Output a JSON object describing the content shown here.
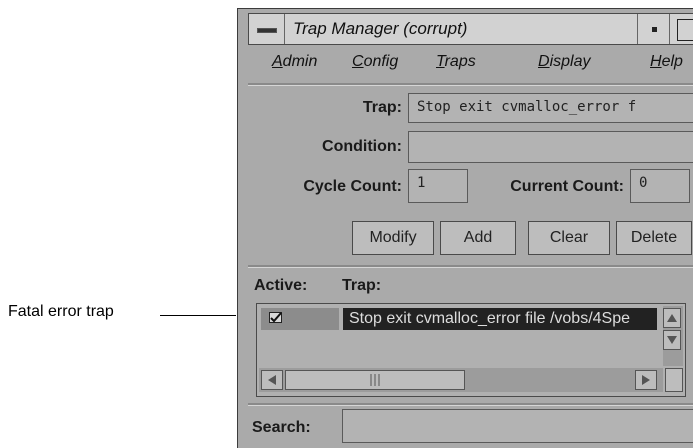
{
  "callout": {
    "label": "Fatal error trap"
  },
  "window": {
    "title": "Trap Manager (corrupt)"
  },
  "menubar": {
    "items": [
      {
        "label": "Admin",
        "underline": "A",
        "rest": "dmin"
      },
      {
        "label": "Config",
        "underline": "C",
        "rest": "onfig"
      },
      {
        "label": "Traps",
        "underline": "T",
        "rest": "raps"
      },
      {
        "label": "Display",
        "underline": "D",
        "rest": "isplay"
      },
      {
        "label": "Help",
        "underline": "H",
        "rest": "elp"
      }
    ]
  },
  "form": {
    "trap_label": "Trap:",
    "trap_value": "Stop exit cvmalloc_error f",
    "condition_label": "Condition:",
    "condition_value": "",
    "cycle_label": "Cycle Count:",
    "cycle_value": "1",
    "current_label": "Current Count:",
    "current_value": "0"
  },
  "buttons": {
    "modify": "Modify",
    "add": "Add",
    "clear": "Clear",
    "delete": "Delete"
  },
  "list": {
    "active_header": "Active:",
    "trap_header": "Trap:",
    "rows": [
      {
        "active": true,
        "trap": "Stop exit cvmalloc_error file /vobs/4Spe"
      }
    ]
  },
  "search": {
    "label": "Search:",
    "value": ""
  }
}
